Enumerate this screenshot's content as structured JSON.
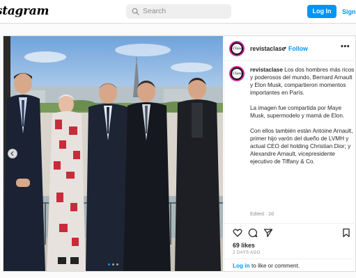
{
  "header": {
    "logo": "Instagram",
    "logo_visible": "stagram",
    "search_placeholder": "Search",
    "login_label": "Log In",
    "signup_label": "Sign"
  },
  "post": {
    "username": "revistaclase",
    "avatar_text": "Clase",
    "separator": "•",
    "follow_label": "Follow",
    "more_icon": "•••",
    "caption_username": "revistaclase",
    "caption_paragraphs": [
      "Los dos hombres más ricos y poderosos del mundo, Bernard Arnault y Elon Musk, compartieron momentos importantes en París.",
      "La imagen fue compartida por Maye Musk, supermodelo y mamá de Elon.",
      "Con ellos también están Antoine Arnault, primer hijo varón del dueño de LVMH y actual CEO del holding Christian Dior; y Alexandre Arnault, vicepresidente ejecutivo de Tiffany & Co."
    ],
    "edited": "Edited · 2d",
    "likes": "69 likes",
    "time_ago": "2 DAYS AGO",
    "login_link": "Log in",
    "login_suffix": "to like or comment.",
    "carousel_dots": 3,
    "carousel_active": 0
  },
  "icons": {
    "search": "search-icon",
    "like": "heart-icon",
    "comment": "comment-icon",
    "share": "share-icon",
    "save": "bookmark-icon",
    "carousel_prev": "chevron-left-icon",
    "more": "more-icon"
  },
  "colors": {
    "accent": "#0095f6",
    "border": "#dbdbdb",
    "muted": "#8e8e8e",
    "text": "#262626",
    "story_ring": "#d6249f"
  }
}
